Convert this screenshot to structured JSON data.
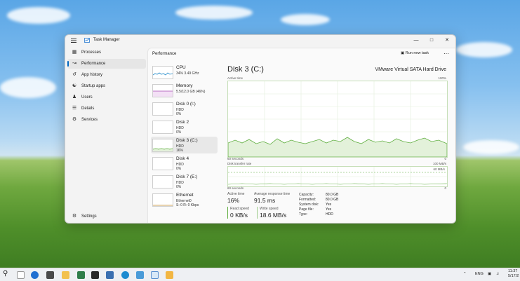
{
  "window": {
    "title": "Task Manager"
  },
  "sidebar": {
    "items": [
      {
        "label": "Processes",
        "icon": "processes-icon"
      },
      {
        "label": "Performance",
        "icon": "performance-icon"
      },
      {
        "label": "App history",
        "icon": "history-icon"
      },
      {
        "label": "Startup apps",
        "icon": "startup-icon"
      },
      {
        "label": "Users",
        "icon": "users-icon"
      },
      {
        "label": "Details",
        "icon": "details-icon"
      },
      {
        "label": "Services",
        "icon": "services-icon"
      }
    ],
    "settings": "Settings",
    "active_index": 1
  },
  "header": {
    "title": "Performance",
    "run_new_task": "Run new task"
  },
  "devices": [
    {
      "name": "CPU",
      "sub1": "34%  3.49 GHz",
      "sub2": "",
      "color": "#1e88c8"
    },
    {
      "name": "Memory",
      "sub1": "5.5/12.0 GB (46%)",
      "sub2": "",
      "color": "#a64cb0"
    },
    {
      "name": "Disk 0 (I:)",
      "sub1": "HDD",
      "sub2": "0%",
      "color": "#5fae3f"
    },
    {
      "name": "Disk 2",
      "sub1": "HDD",
      "sub2": "0%",
      "color": "#5fae3f"
    },
    {
      "name": "Disk 3 (C:)",
      "sub1": "HDD",
      "sub2": "16%",
      "color": "#5fae3f"
    },
    {
      "name": "Disk 4",
      "sub1": "HDD",
      "sub2": "0%",
      "color": "#5fae3f"
    },
    {
      "name": "Disk 7 (E:)",
      "sub1": "HDD",
      "sub2": "0%",
      "color": "#5fae3f"
    },
    {
      "name": "Ethernet",
      "sub1": "Ethernet0",
      "sub2": "S: 0  R: 0 Kbps",
      "color": "#c28a2a"
    }
  ],
  "detail": {
    "title": "Disk 3 (C:)",
    "model": "VMware Virtual SATA Hard Drive",
    "graph1": {
      "label": "Active time",
      "max": "100%",
      "x_left": "60 seconds",
      "x_right": "0"
    },
    "graph2": {
      "label": "Disk transfer rate",
      "max": "100 MB/s",
      "mid": "60 MB/s",
      "x_left": "60 seconds",
      "x_right": "0"
    },
    "stats": {
      "active_time_label": "Active time",
      "active_time": "16%",
      "response_label": "Average response time",
      "response": "91.5 ms",
      "read_label": "Read speed",
      "read": "0 KB/s",
      "write_label": "Write speed",
      "write": "18.6 MB/s"
    },
    "props": [
      {
        "k": "Capacity:",
        "v": "80.0 GB"
      },
      {
        "k": "Formatted:",
        "v": "80.0 GB"
      },
      {
        "k": "System disk:",
        "v": "Yes"
      },
      {
        "k": "Page file:",
        "v": "Yes"
      },
      {
        "k": "Type:",
        "v": "HDD"
      }
    ]
  },
  "taskbar": {
    "lang": "ENG",
    "time": "11:37",
    "date": "5/17/2"
  },
  "colors": {
    "disk_green": "#5fae3f",
    "accent": "#0067c0"
  }
}
